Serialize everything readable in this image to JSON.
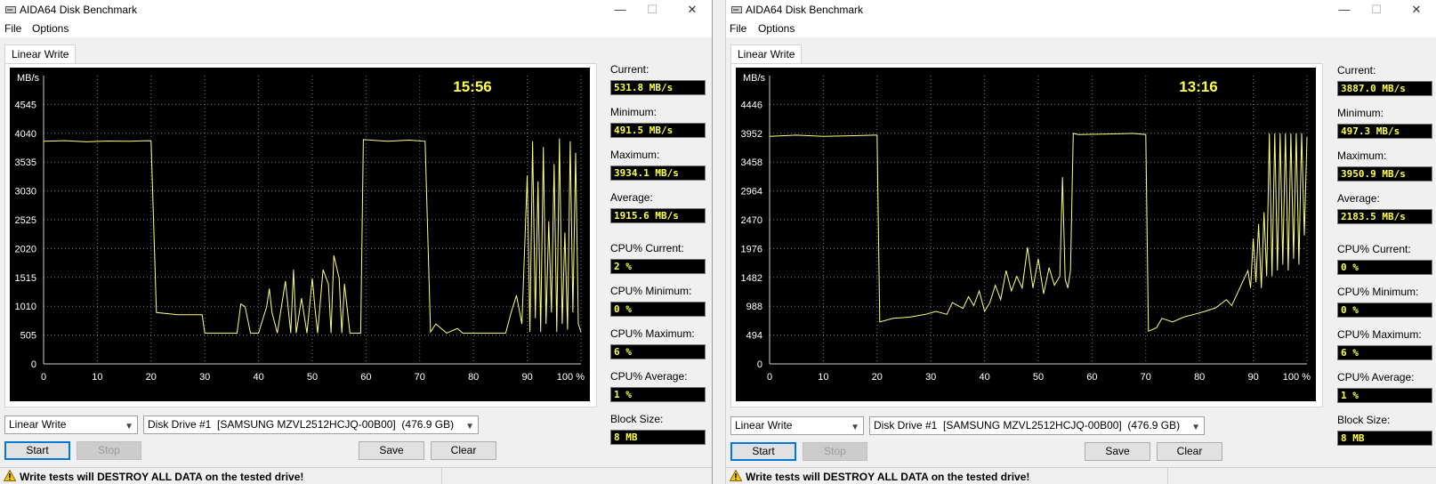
{
  "windows": [
    {
      "title": "AIDA64 Disk Benchmark",
      "titlebar": {
        "minimize": "—",
        "maximize": "☐",
        "close": "✕"
      },
      "menu": [
        "File",
        "Options"
      ],
      "tab": "Linear Write",
      "stats": {
        "current_label": "Current:",
        "current": "531.8 MB/s",
        "minimum_label": "Minimum:",
        "minimum": "491.5 MB/s",
        "maximum_label": "Maximum:",
        "maximum": "3934.1 MB/s",
        "average_label": "Average:",
        "average": "1915.6 MB/s",
        "cpu_current_label": "CPU% Current:",
        "cpu_current": "2 %",
        "cpu_minimum_label": "CPU% Minimum:",
        "cpu_minimum": "0 %",
        "cpu_maximum_label": "CPU% Maximum:",
        "cpu_maximum": "6 %",
        "cpu_average_label": "CPU% Average:",
        "cpu_average": "1 %",
        "block_size_label": "Block Size:",
        "block_size": "8 MB"
      },
      "test_select": "Linear Write",
      "drive_select": "Disk Drive #1  [SAMSUNG MZVL2512HCJQ-00B00]  (476.9 GB)",
      "buttons": {
        "start": "Start",
        "stop": "Stop",
        "save": "Save",
        "clear": "Clear"
      },
      "warning": "Write tests will DESTROY ALL DATA on the tested drive!",
      "chart_data": {
        "type": "line",
        "time_label": "15:56",
        "ylabel": "MB/s",
        "yticks": [
          "0",
          "505",
          "1010",
          "1515",
          "2020",
          "2525",
          "3030",
          "3535",
          "4040",
          "4545"
        ],
        "ylim": [
          0,
          5050
        ],
        "xticks": [
          "0",
          "10",
          "20",
          "30",
          "40",
          "50",
          "60",
          "70",
          "80",
          "90",
          "100 %"
        ],
        "xlim": [
          0,
          100
        ],
        "grid": true,
        "line_color": "#ffff80",
        "series": [
          {
            "x": [
              0,
              4,
              8,
              12,
              16,
              19.5,
              20,
              21,
              25,
              29.5,
              30,
              33,
              36,
              36.7,
              37.5,
              38.5,
              40,
              41.5,
              42,
              42.5,
              43.5,
              45,
              46,
              46.5,
              47,
              48,
              49,
              50,
              50.5,
              51,
              52,
              53,
              53.5,
              54,
              55,
              55.5,
              56,
              57,
              58,
              59,
              59.5,
              64,
              68,
              71,
              72,
              73,
              75,
              77,
              78,
              80,
              82,
              84,
              86,
              87,
              88,
              89,
              90,
              90.5,
              91,
              91.5,
              92,
              92.5,
              93,
              93.5,
              94,
              94.5,
              95,
              95.5,
              96,
              96.5,
              97,
              97.5,
              98,
              98.5,
              99,
              99.5,
              100
            ],
            "y": [
              3900,
              3910,
              3890,
              3905,
              3900,
              3910,
              3900,
              900,
              860,
              860,
              540,
              540,
              540,
              1050,
              1000,
              540,
              540,
              1000,
              1320,
              900,
              540,
              1450,
              540,
              1650,
              540,
              1150,
              540,
              1500,
              980,
              540,
              1650,
              1400,
              540,
              1900,
              1500,
              540,
              1400,
              540,
              540,
              540,
              3930,
              3900,
              3920,
              3900,
              560,
              700,
              540,
              620,
              540,
              540,
              540,
              540,
              540,
              900,
              1200,
              700,
              3300,
              560,
              3900,
              800,
              3200,
              560,
              3800,
              700,
              2500,
              900,
              3500,
              560,
              3950,
              700,
              2300,
              600,
              3900,
              900,
              3700,
              700,
              560
            ]
          }
        ]
      }
    },
    {
      "title": "AIDA64 Disk Benchmark",
      "titlebar": {
        "minimize": "—",
        "maximize": "☐",
        "close": "✕"
      },
      "menu": [
        "File",
        "Options"
      ],
      "tab": "Linear Write",
      "stats": {
        "current_label": "Current:",
        "current": "3887.0 MB/s",
        "minimum_label": "Minimum:",
        "minimum": "497.3 MB/s",
        "maximum_label": "Maximum:",
        "maximum": "3950.9 MB/s",
        "average_label": "Average:",
        "average": "2183.5 MB/s",
        "cpu_current_label": "CPU% Current:",
        "cpu_current": "0 %",
        "cpu_minimum_label": "CPU% Minimum:",
        "cpu_minimum": "0 %",
        "cpu_maximum_label": "CPU% Maximum:",
        "cpu_maximum": "6 %",
        "cpu_average_label": "CPU% Average:",
        "cpu_average": "1 %",
        "block_size_label": "Block Size:",
        "block_size": "8 MB"
      },
      "test_select": "Linear Write",
      "drive_select": "Disk Drive #1  [SAMSUNG MZVL2512HCJQ-00B00]  (476.9 GB)",
      "buttons": {
        "start": "Start",
        "stop": "Stop",
        "save": "Save",
        "clear": "Clear"
      },
      "warning": "Write tests will DESTROY ALL DATA on the tested drive!",
      "chart_data": {
        "type": "line",
        "time_label": "13:16",
        "ylabel": "MB/s",
        "yticks": [
          "0",
          "494",
          "988",
          "1482",
          "1976",
          "2470",
          "2964",
          "3458",
          "3952",
          "4446"
        ],
        "ylim": [
          0,
          4940
        ],
        "xticks": [
          "0",
          "10",
          "20",
          "30",
          "40",
          "50",
          "60",
          "70",
          "80",
          "90",
          "100 %"
        ],
        "xlim": [
          0,
          100
        ],
        "grid": true,
        "line_color": "#ffff80",
        "series": [
          {
            "x": [
              0,
              5,
              10,
              15,
              19.5,
              20,
              20.5,
              23,
              26,
              29,
              31,
              33,
              34,
              36,
              37,
              38,
              39,
              40,
              41,
              42,
              43,
              44,
              45,
              46,
              47,
              48,
              49,
              50,
              51,
              52,
              53,
              54,
              54.5,
              55,
              55.5,
              56,
              56.5,
              57,
              57.5,
              63,
              67.5,
              70,
              70.5,
              72,
              73,
              75,
              77,
              79,
              81,
              83,
              85,
              86,
              87,
              88,
              89,
              89.5,
              90,
              90.5,
              91,
              91.5,
              92,
              92.5,
              93,
              93.5,
              94,
              94.5,
              95,
              95.5,
              96,
              96.5,
              97,
              97.5,
              98,
              98.5,
              99,
              99.5,
              100
            ],
            "y": [
              3900,
              3920,
              3900,
              3910,
              3920,
              3920,
              720,
              780,
              800,
              850,
              900,
              850,
              1050,
              950,
              1150,
              1000,
              1250,
              900,
              1050,
              1350,
              1100,
              1600,
              1250,
              1500,
              1300,
              2000,
              1300,
              1800,
              1200,
              1650,
              1350,
              1500,
              3200,
              1450,
              1300,
              1600,
              3950,
              3940,
              3930,
              3940,
              3950,
              3930,
              560,
              620,
              780,
              720,
              800,
              850,
              900,
              960,
              1100,
              1000,
              1200,
              1400,
              1600,
              1300,
              2150,
              1400,
              2400,
              1300,
              2600,
              1500,
              3950,
              1500,
              3950,
              1600,
              3950,
              1700,
              3950,
              1600,
              3950,
              1800,
              3950,
              1700,
              3950,
              2200,
              3887
            ]
          }
        ]
      }
    }
  ]
}
